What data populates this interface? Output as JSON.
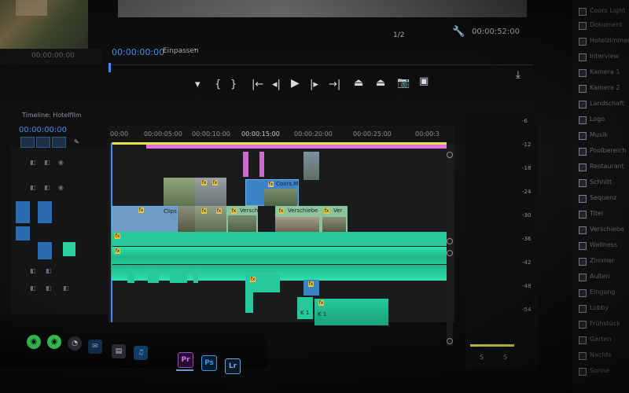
{
  "colors": {
    "accent_blue": "#3f8ee8",
    "video_clip": "#3a83c6",
    "audio_clip": "#26c99b",
    "pink_clip": "#d168d2",
    "yellow_bar": "#e5e14a",
    "pink_bar": "#e070e0",
    "fx_badge": "#e5c64a"
  },
  "program_monitor": {
    "timecode": "00:00:00:00",
    "fit_label": "Einpassen",
    "dropdown_icon": "chevron-down-icon",
    "quality": "1/2",
    "duration": "00:00:52:00"
  },
  "source_monitor": {
    "timecode": "00:00:00:00"
  },
  "transport_icons": [
    "marker-icon",
    "mark-in-icon",
    "mark-out-icon",
    "go-to-in-icon",
    "step-back-icon",
    "play-icon",
    "step-forward-icon",
    "go-to-out-icon",
    "lift-icon",
    "extract-icon",
    "export-frame-icon",
    "compare-icon"
  ],
  "timeline": {
    "sequence_name": "Timeline: Hotelfilm",
    "playhead_timecode": "00:00:00:00",
    "ruler": [
      "00:00",
      "00:00:05:00",
      "00:00:10:00",
      "00:00:15:00",
      "00:00:20:00",
      "00:00:25:00",
      "00:00:3"
    ],
    "clip_labels": {
      "coors": "Coors.MP",
      "clip1": "Clips",
      "versch1": "Versch",
      "versch2": "Verschiebe",
      "versch3": "Ver",
      "k1a": "K 1",
      "k1b": "K 1"
    },
    "fx_label": "fx"
  },
  "audio_meter": {
    "ticks": [
      "-6",
      "-12",
      "-18",
      "-24",
      "-30",
      "-36",
      "-42",
      "-48",
      "-54"
    ],
    "solo_left": "S",
    "solo_right": "S"
  },
  "project_list": {
    "items": [
      "Coors Light",
      "Dokument",
      "Hotelzimmer",
      "Interview",
      "Kamera 1",
      "Kamera 2",
      "Landschaft",
      "Logo",
      "Musik",
      "Poolbereich",
      "Restaurant",
      "Schnitt",
      "Sequenz",
      "Titel",
      "Verschiebe",
      "Wellness",
      "Zimmer",
      "Außen",
      "Eingang",
      "Lobby",
      "Frühstück",
      "Garten",
      "Nachts",
      "Sonne"
    ]
  },
  "taskbar": {
    "premiere": "Pr",
    "photoshop": "Ps",
    "lightroom": "Lr"
  }
}
